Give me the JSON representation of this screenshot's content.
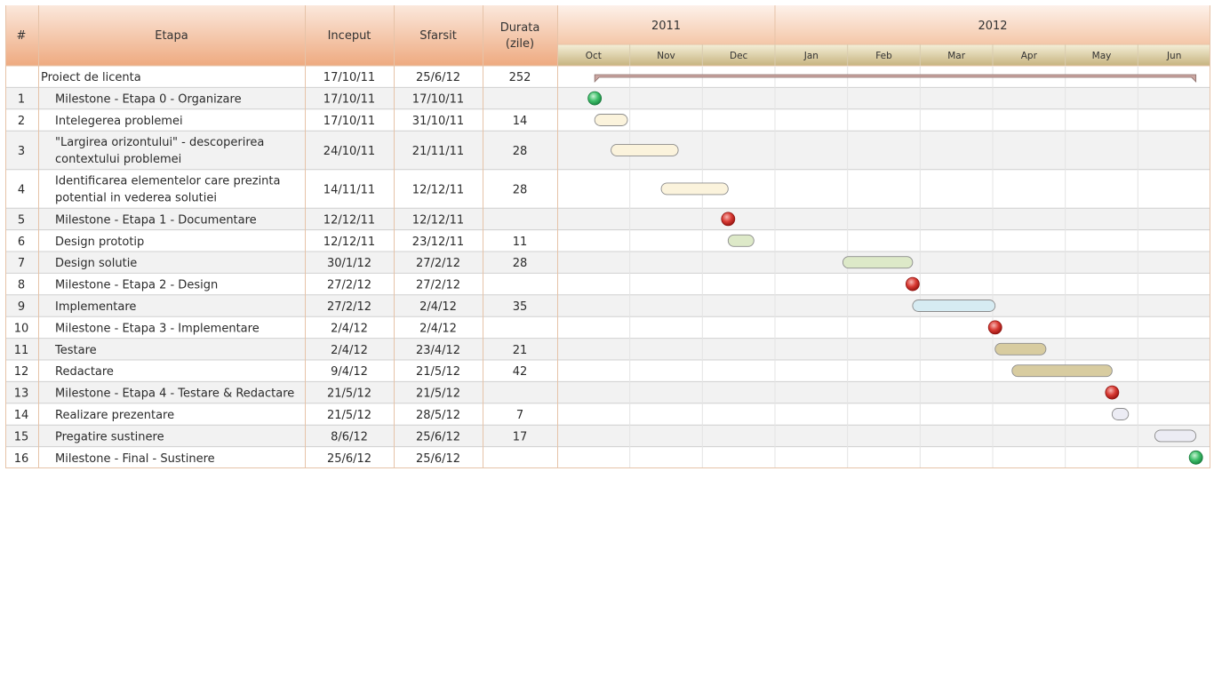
{
  "header": {
    "col_num": "#",
    "col_task": "Etapa",
    "col_start": "Inceput",
    "col_end": "Sfarsit",
    "col_duration_line1": "Durata",
    "col_duration_line2": "(zile)"
  },
  "colors": {
    "header_gradient_top": "#fbe8dc",
    "header_gradient_bottom": "#eeaa80",
    "month_gradient_top": "#f3ecd2",
    "month_gradient_bottom": "#c9b785",
    "row_alt": "#f2f2f2",
    "row_plain": "#ffffff",
    "grid_border": "#e6c3a8",
    "milestone_green": "#1f9e46",
    "milestone_red": "#c00000",
    "text_default": "#2b2b2b"
  },
  "chart_data": {
    "type": "gantt",
    "years": [
      {
        "label": "2011",
        "months": 3
      },
      {
        "label": "2012",
        "months": 6
      }
    ],
    "months": [
      "Oct",
      "Nov",
      "Dec",
      "Jan",
      "Feb",
      "Mar",
      "Apr",
      "May",
      "Jun"
    ],
    "summary": {
      "name": "Proiect de licenta",
      "start": "17/10/11",
      "end": "25/6/12",
      "duration": "252",
      "start_date": "2011-10-17",
      "end_date": "2012-06-25"
    },
    "tasks": [
      {
        "num": "1",
        "name_lines": [
          "Milestone - Etapa 0 - Organizare"
        ],
        "start": "17/10/11",
        "end": "17/10/11",
        "duration": "",
        "start_date": "2011-10-17",
        "end_date": "2011-10-17",
        "kind": "milestone",
        "color": "green"
      },
      {
        "num": "2",
        "name_lines": [
          "Intelegerea problemei"
        ],
        "start": "17/10/11",
        "end": "31/10/11",
        "duration": "14",
        "start_date": "2011-10-17",
        "end_date": "2011-10-31",
        "kind": "task",
        "color": "#fbf3dc"
      },
      {
        "num": "3",
        "name_lines": [
          "\"Largirea orizontului\" - descoperirea",
          "contextului problemei"
        ],
        "start": "24/10/11",
        "end": "21/11/11",
        "duration": "28",
        "start_date": "2011-10-24",
        "end_date": "2011-11-21",
        "kind": "task",
        "color": "#fbf3dc"
      },
      {
        "num": "4",
        "name_lines": [
          "Identificarea elementelor care prezinta",
          "potential in vederea solutiei"
        ],
        "start": "14/11/11",
        "end": "12/12/11",
        "duration": "28",
        "start_date": "2011-11-14",
        "end_date": "2011-12-12",
        "kind": "task",
        "color": "#fbf3dc"
      },
      {
        "num": "5",
        "name_lines": [
          "Milestone - Etapa 1 - Documentare"
        ],
        "start": "12/12/11",
        "end": "12/12/11",
        "duration": "",
        "start_date": "2011-12-12",
        "end_date": "2011-12-12",
        "kind": "milestone",
        "color": "red"
      },
      {
        "num": "6",
        "name_lines": [
          "Design prototip"
        ],
        "start": "12/12/11",
        "end": "23/12/11",
        "duration": "11",
        "start_date": "2011-12-12",
        "end_date": "2011-12-23",
        "kind": "task",
        "color": "#dde9c8"
      },
      {
        "num": "7",
        "name_lines": [
          "Design solutie"
        ],
        "start": "30/1/12",
        "end": "27/2/12",
        "duration": "28",
        "start_date": "2012-01-30",
        "end_date": "2012-02-27",
        "kind": "task",
        "color": "#dde9c8"
      },
      {
        "num": "8",
        "name_lines": [
          "Milestone - Etapa 2 - Design"
        ],
        "start": "27/2/12",
        "end": "27/2/12",
        "duration": "",
        "start_date": "2012-02-27",
        "end_date": "2012-02-27",
        "kind": "milestone",
        "color": "red"
      },
      {
        "num": "9",
        "name_lines": [
          "Implementare"
        ],
        "start": "27/2/12",
        "end": "2/4/12",
        "duration": "35",
        "start_date": "2012-02-27",
        "end_date": "2012-04-02",
        "kind": "task",
        "color": "#d6ebf2"
      },
      {
        "num": "10",
        "name_lines": [
          "Milestone - Etapa 3 - Implementare"
        ],
        "start": "2/4/12",
        "end": "2/4/12",
        "duration": "",
        "start_date": "2012-04-02",
        "end_date": "2012-04-02",
        "kind": "milestone",
        "color": "red"
      },
      {
        "num": "11",
        "name_lines": [
          "Testare"
        ],
        "start": "2/4/12",
        "end": "23/4/12",
        "duration": "21",
        "start_date": "2012-04-02",
        "end_date": "2012-04-23",
        "kind": "task",
        "color": "#d8cca0"
      },
      {
        "num": "12",
        "name_lines": [
          "Redactare"
        ],
        "start": "9/4/12",
        "end": "21/5/12",
        "duration": "42",
        "start_date": "2012-04-09",
        "end_date": "2012-05-21",
        "kind": "task",
        "color": "#d8cca0"
      },
      {
        "num": "13",
        "name_lines": [
          "Milestone - Etapa 4 - Testare & Redactare"
        ],
        "start": "21/5/12",
        "end": "21/5/12",
        "duration": "",
        "start_date": "2012-05-21",
        "end_date": "2012-05-21",
        "kind": "milestone",
        "color": "red"
      },
      {
        "num": "14",
        "name_lines": [
          "Realizare prezentare"
        ],
        "start": "21/5/12",
        "end": "28/5/12",
        "duration": "7",
        "start_date": "2012-05-21",
        "end_date": "2012-05-28",
        "kind": "task",
        "color": "#ececf4"
      },
      {
        "num": "15",
        "name_lines": [
          "Pregatire sustinere"
        ],
        "start": "8/6/12",
        "end": "25/6/12",
        "duration": "17",
        "start_date": "2012-06-08",
        "end_date": "2012-06-25",
        "kind": "task",
        "color": "#ececf4"
      },
      {
        "num": "16",
        "name_lines": [
          "Milestone - Final - Sustinere"
        ],
        "start": "25/6/12",
        "end": "25/6/12",
        "duration": "",
        "start_date": "2012-06-25",
        "end_date": "2012-06-25",
        "kind": "milestone",
        "color": "green"
      }
    ]
  }
}
